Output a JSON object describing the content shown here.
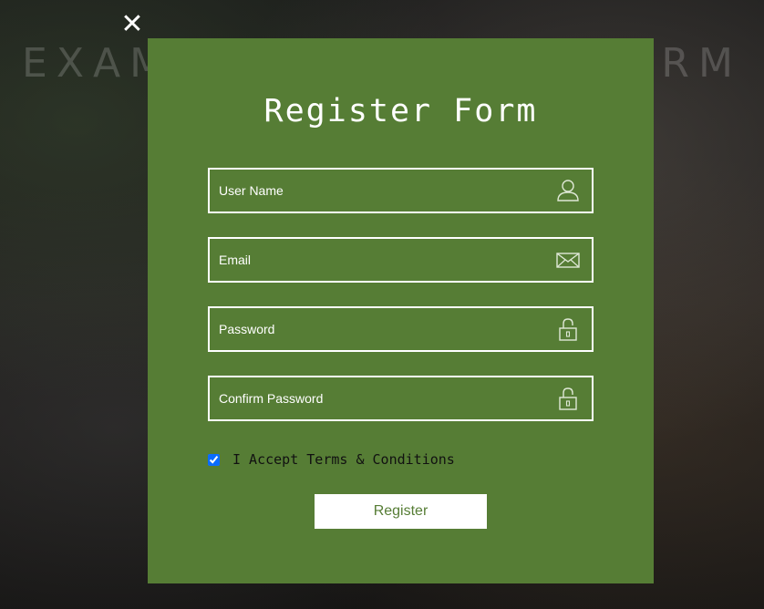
{
  "background": {
    "title": "EXAMPLE REGISTER FORM"
  },
  "modal": {
    "close_symbol": "✕",
    "title": "Register Form",
    "fields": [
      {
        "placeholder": "User Name",
        "value": "",
        "icon": "user-icon"
      },
      {
        "placeholder": "Email",
        "value": "",
        "icon": "envelope-icon"
      },
      {
        "placeholder": "Password",
        "value": "",
        "icon": "lock-icon"
      },
      {
        "placeholder": "Confirm Password",
        "value": "",
        "icon": "lock-icon"
      }
    ],
    "terms": {
      "label": "I Accept Terms & Conditions",
      "checked": true
    },
    "register_label": "Register"
  },
  "colors": {
    "modal_background": "#567d35",
    "field_border": "#ffffff",
    "button_background": "#ffffff",
    "button_text": "#567d35"
  }
}
